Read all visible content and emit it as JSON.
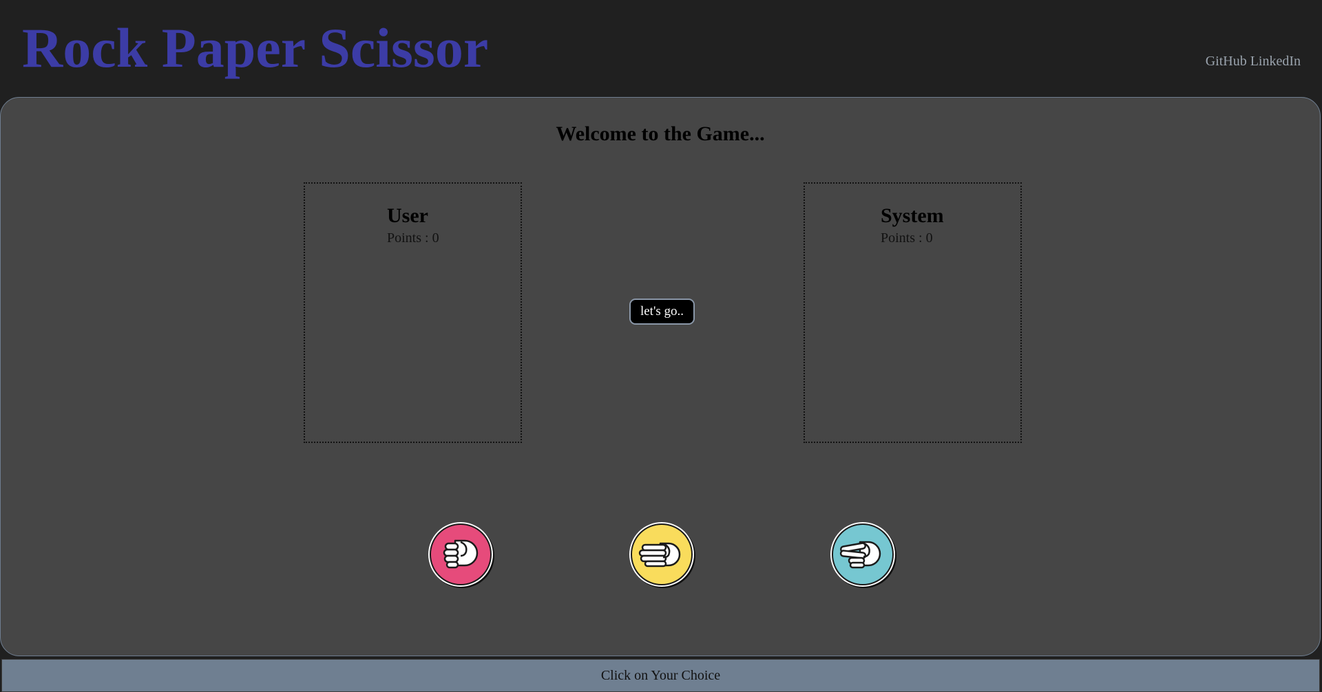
{
  "header": {
    "title": "Rock Paper Scissor",
    "links": [
      "GitHub",
      "LinkedIn"
    ],
    "title_color": "#3c3ca6"
  },
  "game": {
    "welcome": "Welcome to the Game...",
    "user": {
      "name": "User",
      "points": "Points : 0"
    },
    "system": {
      "name": "System",
      "points": "Points : 0"
    },
    "start_button": "let's go..",
    "choices": [
      {
        "name": "rock",
        "icon": "fist-icon",
        "color": "#e64b7b"
      },
      {
        "name": "paper",
        "icon": "open-hand-icon",
        "color": "#f9dc5c"
      },
      {
        "name": "scissors",
        "icon": "peace-hand-icon",
        "color": "#76c7d1"
      }
    ]
  },
  "footer": {
    "instruction": "Click on Your Choice"
  }
}
